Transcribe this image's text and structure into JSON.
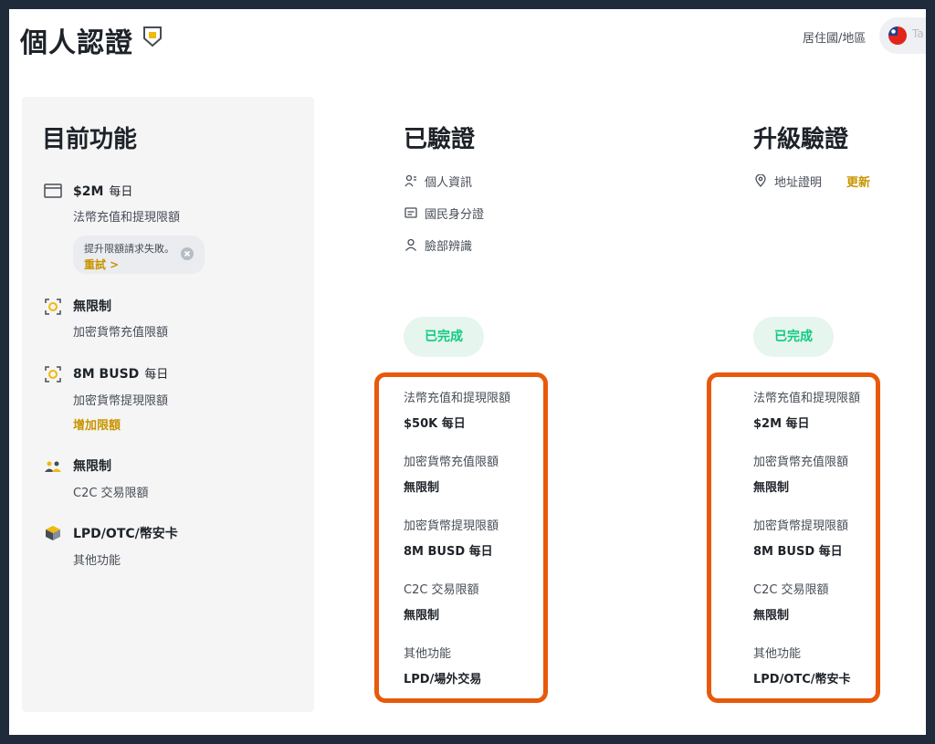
{
  "header": {
    "title": "個人認證",
    "residence_label": "居住國/地區",
    "country_text": "Ta"
  },
  "current": {
    "heading": "目前功能",
    "features": [
      {
        "icon": "card-icon",
        "title": "$2M",
        "unit": "每日",
        "sub": "法幣充值和提現限額"
      },
      {
        "icon": "crypto-deposit-icon",
        "title": "無限制",
        "unit": "",
        "sub": "加密貨幣充值限額"
      },
      {
        "icon": "crypto-withdraw-icon",
        "title": "8M BUSD",
        "unit": "每日",
        "sub": "加密貨幣提現限額",
        "link": "增加限額"
      },
      {
        "icon": "c2c-users-icon",
        "title": "無限制",
        "unit": "",
        "sub": "C2C 交易限額"
      },
      {
        "icon": "cube-icon",
        "title": "LPD/OTC/幣安卡",
        "unit": "",
        "sub": "其他功能"
      }
    ],
    "error": {
      "text": "提升限額請求失敗。",
      "retry": "重試 >"
    }
  },
  "verified": {
    "heading": "已驗證",
    "items": [
      {
        "icon": "personal-info-icon",
        "label": "個人資訊"
      },
      {
        "icon": "id-card-icon",
        "label": "國民身分證"
      },
      {
        "icon": "face-icon",
        "label": "臉部辨識"
      }
    ],
    "status": "已完成",
    "limits": [
      {
        "label": "法幣充值和提現限額",
        "value": "$50K 每日"
      },
      {
        "label": "加密貨幣充值限額",
        "value": "無限制"
      },
      {
        "label": "加密貨幣提現限額",
        "value": "8M BUSD 每日"
      },
      {
        "label": "C2C 交易限額",
        "value": "無限制"
      },
      {
        "label": "其他功能",
        "value": "LPD/場外交易"
      }
    ]
  },
  "upgrade": {
    "heading": "升級驗證",
    "items": [
      {
        "icon": "location-icon",
        "label": "地址證明",
        "action": "更新"
      }
    ],
    "status": "已完成",
    "limits": [
      {
        "label": "法幣充值和提現限額",
        "value": "$2M 每日"
      },
      {
        "label": "加密貨幣充值限額",
        "value": "無限制"
      },
      {
        "label": "加密貨幣提現限額",
        "value": "8M BUSD 每日"
      },
      {
        "label": "C2C 交易限額",
        "value": "無限制"
      },
      {
        "label": "其他功能",
        "value": "LPD/OTC/幣安卡"
      }
    ]
  },
  "colors": {
    "accent": "#c99400",
    "success": "#0ecb81",
    "highlight_border": "#e8590c"
  }
}
